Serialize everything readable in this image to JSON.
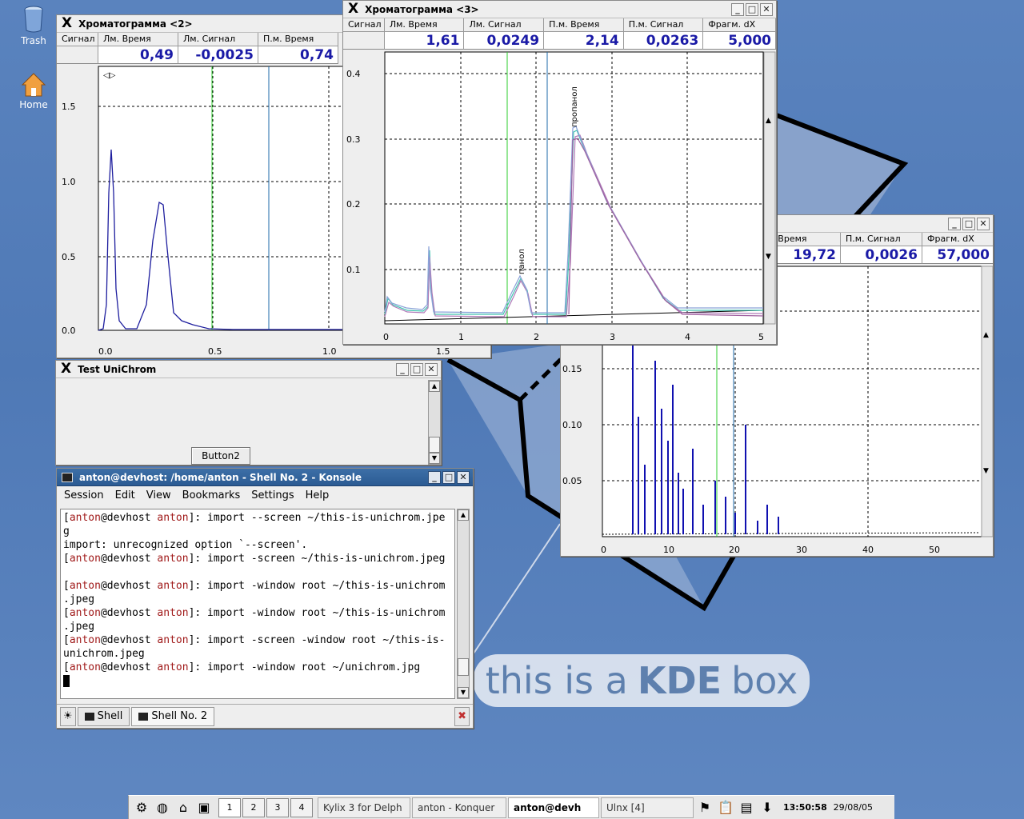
{
  "desktop": {
    "icons": [
      {
        "label": "Trash"
      },
      {
        "label": "Home"
      }
    ],
    "banner": {
      "part1": "this is a",
      "part2": "KDE",
      "part3": "box"
    }
  },
  "chrom2": {
    "title": "Хроматограмма <2>",
    "headers": [
      "Сигнал",
      "Лм. Время",
      "Лм. Сигнал",
      "П.м. Время"
    ],
    "values": [
      "",
      "0,49",
      "-0,0025",
      "0,74"
    ],
    "y_ticks": [
      "1.5",
      "1.0",
      "0.5",
      "0.0"
    ],
    "x_ticks": [
      "0.0",
      "0.5",
      "1.0",
      "1.5"
    ]
  },
  "chrom3": {
    "title": "Хроматограмма <3>",
    "headers": [
      "Сигнал",
      "Лм. Время",
      "Лм. Сигнал",
      "П.м. Время",
      "П.м. Сигнал",
      "Фрагм. dX"
    ],
    "values": [
      "",
      "1,61",
      "0,0249",
      "2,14",
      "0,0263",
      "5,000"
    ],
    "y_ticks": [
      "0.4",
      "0.3",
      "0.2",
      "0.1"
    ],
    "x_ticks": [
      "0",
      "1",
      "2",
      "3",
      "4",
      "5"
    ],
    "peak_labels": [
      "панол",
      "пропанол"
    ]
  },
  "chrom4": {
    "headers": [
      "м. Время",
      "П.м. Сигнал",
      "Фрагм. dX"
    ],
    "values": [
      "19,72",
      "0,0026",
      "57,000"
    ],
    "y_ticks": [
      "0.15",
      "0.10",
      "0.05"
    ],
    "x_ticks": [
      "0",
      "10",
      "20",
      "30",
      "40",
      "50"
    ]
  },
  "testwin": {
    "title": "Test UniChrom",
    "button_label": "Button2"
  },
  "konsole": {
    "title": "anton@devhost: /home/anton - Shell No. 2 - Konsole",
    "menu": [
      "Session",
      "Edit",
      "View",
      "Bookmarks",
      "Settings",
      "Help"
    ],
    "lines": [
      {
        "pre": "[",
        "user": "anton",
        "at": "@devhost ",
        "dir": "anton",
        "cmd": "]: import --screen ~/this-is-unichrom.jpe"
      },
      {
        "pre": "",
        "user": "",
        "at": "",
        "dir": "",
        "cmd": "g"
      },
      {
        "pre": "",
        "user": "",
        "at": "",
        "dir": "",
        "cmd": "import: unrecognized option `--screen'."
      },
      {
        "pre": "[",
        "user": "anton",
        "at": "@devhost ",
        "dir": "anton",
        "cmd": "]: import -screen ~/this-is-unichrom.jpeg"
      },
      {
        "pre": "",
        "user": "",
        "at": "",
        "dir": "",
        "cmd": " "
      },
      {
        "pre": "[",
        "user": "anton",
        "at": "@devhost ",
        "dir": "anton",
        "cmd": "]: import -window root ~/this-is-unichrom"
      },
      {
        "pre": "",
        "user": "",
        "at": "",
        "dir": "",
        "cmd": ".jpeg"
      },
      {
        "pre": "[",
        "user": "anton",
        "at": "@devhost ",
        "dir": "anton",
        "cmd": "]: import -window root ~/this-is-unichrom"
      },
      {
        "pre": "",
        "user": "",
        "at": "",
        "dir": "",
        "cmd": ".jpeg"
      },
      {
        "pre": "[",
        "user": "anton",
        "at": "@devhost ",
        "dir": "anton",
        "cmd": "]: import -screen -window root ~/this-is-"
      },
      {
        "pre": "",
        "user": "",
        "at": "",
        "dir": "",
        "cmd": "unichrom.jpeg"
      },
      {
        "pre": "[",
        "user": "anton",
        "at": "@devhost ",
        "dir": "anton",
        "cmd": "]: import -window root ~/unichrom.jpg"
      }
    ],
    "tabs": [
      "Shell",
      "Shell No. 2"
    ]
  },
  "taskbar": {
    "desktops": [
      "1",
      "2",
      "3",
      "4"
    ],
    "tasks": [
      "Kylix 3 for Delph",
      "anton - Konquer",
      "anton@devh",
      "Ulnx [4]"
    ],
    "clock": "13:50:58",
    "date": "29/08/05"
  }
}
